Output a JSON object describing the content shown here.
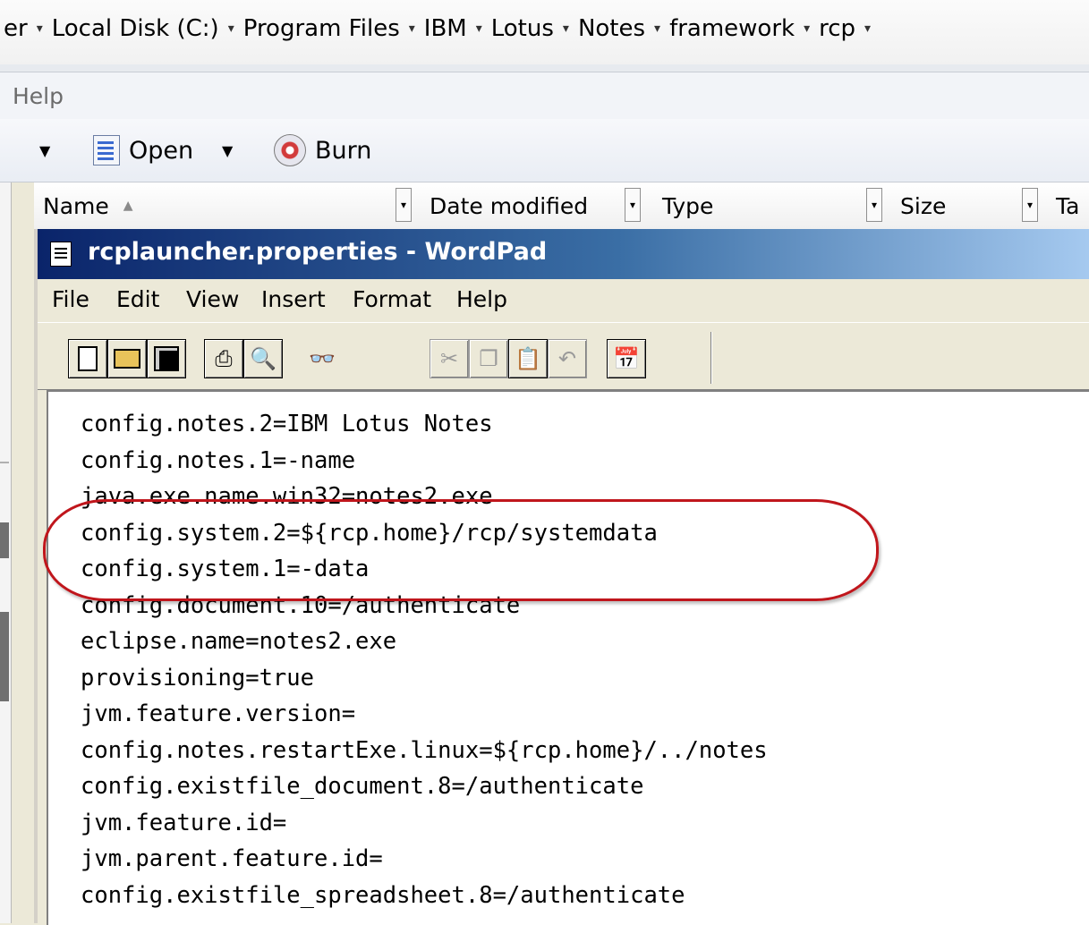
{
  "address_bar": {
    "crumbs": [
      "er",
      "Local Disk (C:)",
      "Program Files",
      "IBM",
      "Lotus",
      "Notes",
      "framework",
      "rcp"
    ],
    "separator": "▾"
  },
  "explorer_menu": {
    "help": "Help"
  },
  "explorer_toolbar": {
    "open_label": "Open",
    "burn_label": "Burn",
    "dropdown_glyph": "▼"
  },
  "columns": {
    "name": "Name",
    "sort_glyph": "▲",
    "date_modified": "Date modified",
    "type": "Type",
    "size": "Size",
    "tags": "Ta",
    "filter_glyph": "▾"
  },
  "wordpad": {
    "title": "rcplauncher.properties - WordPad",
    "menu": [
      "File",
      "Edit",
      "View",
      "Insert",
      "Format",
      "Help"
    ],
    "toolbar_icons": [
      "new-icon",
      "open-icon",
      "save-icon",
      "print-icon",
      "print-preview-icon",
      "find-icon",
      "cut-icon",
      "copy-icon",
      "paste-icon",
      "undo-icon",
      "date-time-icon"
    ],
    "lines": [
      "config.notes.2=IBM Lotus Notes",
      "config.notes.1=-name",
      "java.exe.name.win32=notes2.exe",
      "config.system.2=${rcp.home}/rcp/systemdata",
      "config.system.1=-data",
      "config.document.10=/authenticate",
      "eclipse.name=notes2.exe",
      "provisioning=true",
      "jvm.feature.version=",
      "config.notes.restartExe.linux=${rcp.home}/../notes",
      "config.existfile_document.8=/authenticate",
      "jvm.feature.id=",
      "jvm.parent.feature.id=",
      "config.existfile_spreadsheet.8=/authenticate"
    ]
  },
  "highlight_color": "#c0161c"
}
